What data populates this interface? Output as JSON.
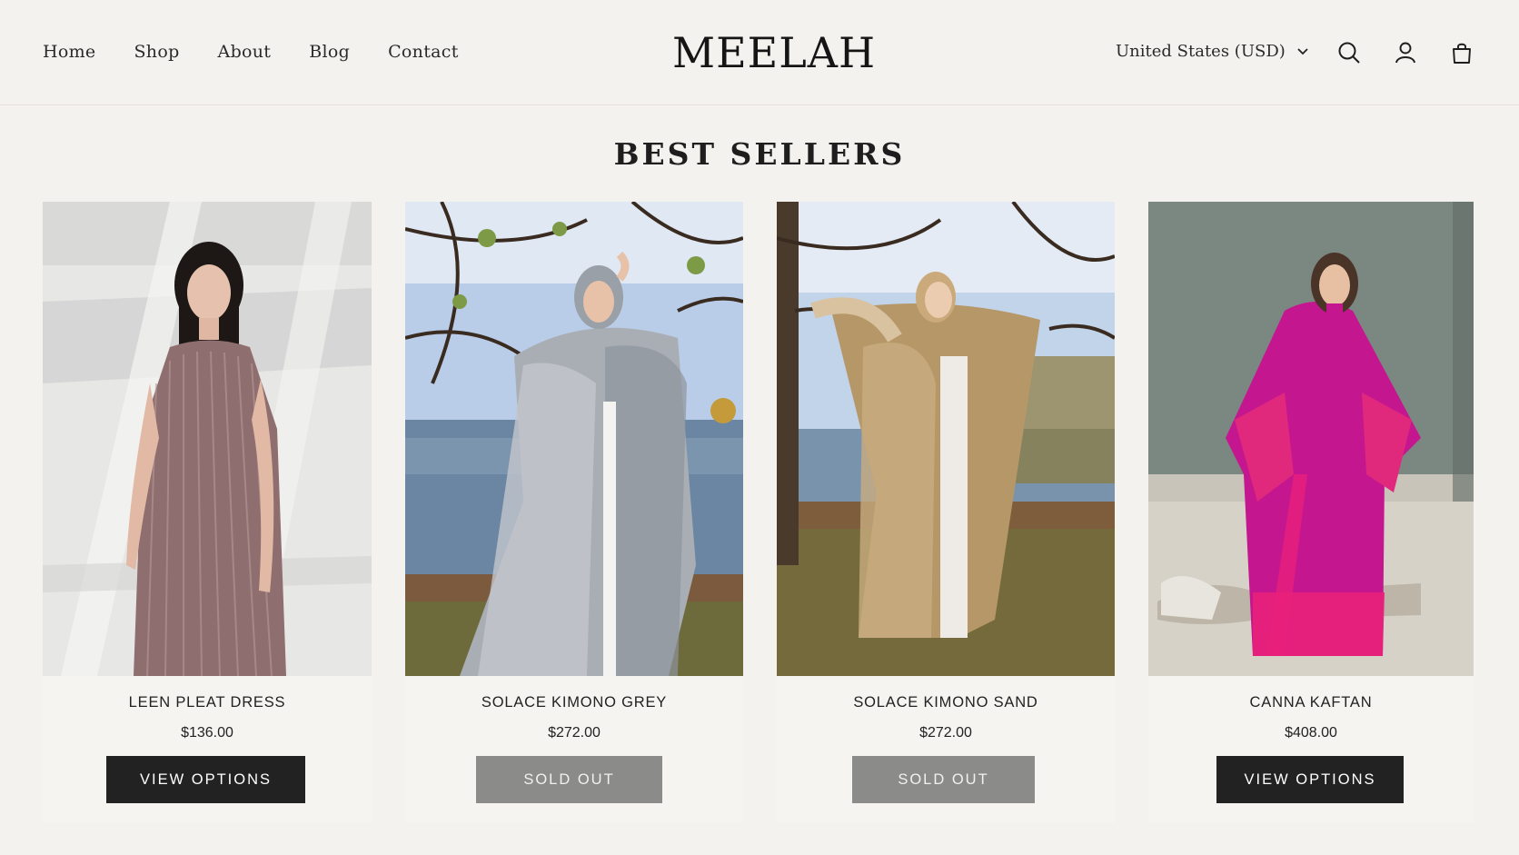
{
  "header": {
    "nav": [
      "Home",
      "Shop",
      "About",
      "Blog",
      "Contact"
    ],
    "logo": "MEELAH",
    "currency": "United States (USD)",
    "icons": [
      "search-icon",
      "account-icon",
      "cart-icon"
    ]
  },
  "section": {
    "title": "BEST SELLERS"
  },
  "products": [
    {
      "name": "LEEN PLEAT DRESS",
      "price": "$136.00",
      "button": "VIEW OPTIONS",
      "status": "available"
    },
    {
      "name": "SOLACE KIMONO GREY",
      "price": "$272.00",
      "button": "SOLD OUT",
      "status": "sold-out"
    },
    {
      "name": "SOLACE KIMONO SAND",
      "price": "$272.00",
      "button": "SOLD OUT",
      "status": "sold-out"
    },
    {
      "name": "CANNA KAFTAN",
      "price": "$408.00",
      "button": "VIEW OPTIONS",
      "status": "available"
    }
  ],
  "colors": {
    "background": "#f4f2ee",
    "button_dark": "#222222",
    "button_sold_out": "#8b8b89",
    "accent_kaftan": "#c4168f"
  }
}
